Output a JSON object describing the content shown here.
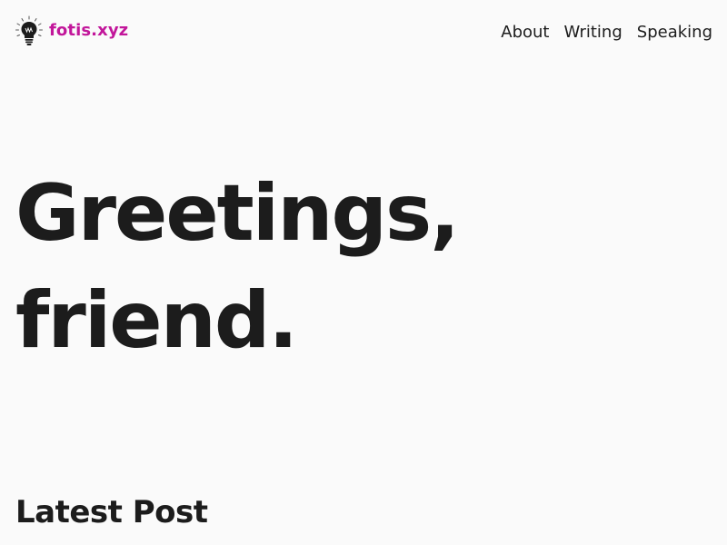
{
  "header": {
    "logo": {
      "icon": "lightbulb-icon",
      "text": "fotis.xyz",
      "color": "#c2169a"
    },
    "nav": [
      {
        "label": "About"
      },
      {
        "label": "Writing"
      },
      {
        "label": "Speaking"
      }
    ]
  },
  "hero": {
    "line1": "Greetings,",
    "line2": "friend."
  },
  "sections": {
    "latest_post_title": "Latest Post"
  },
  "colors": {
    "background": "#fafafa",
    "text": "#1c1c1c",
    "accent": "#c2169a"
  }
}
